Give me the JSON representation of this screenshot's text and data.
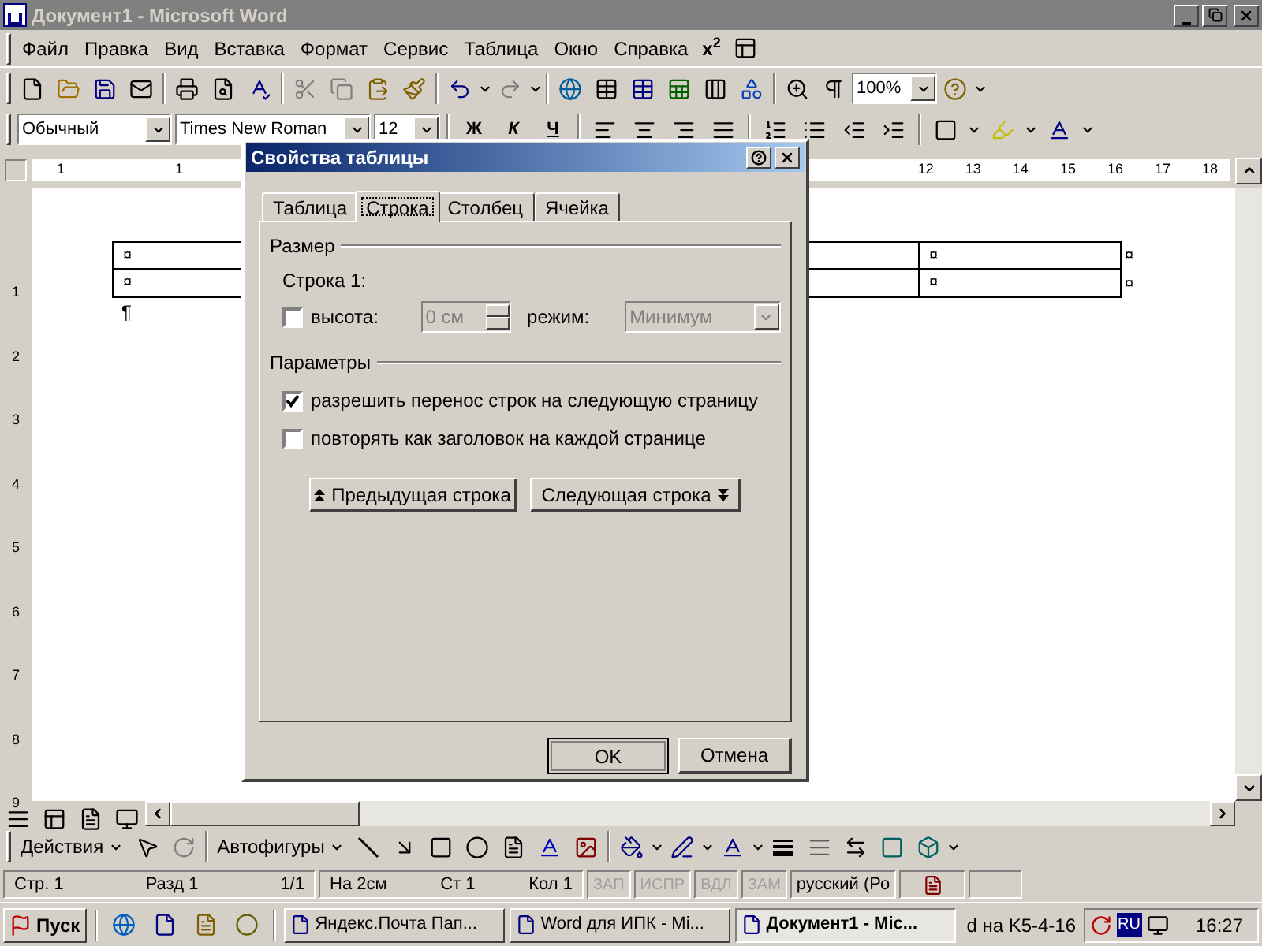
{
  "window": {
    "title": "Документ1 - Microsoft Word"
  },
  "menu": [
    "Файл",
    "Правка",
    "Вид",
    "Вставка",
    "Формат",
    "Сервис",
    "Таблица",
    "Окно",
    "Справка"
  ],
  "superscript_button": "x$^{2}$",
  "standard_toolbar": {
    "zoom": "100%"
  },
  "formatting_toolbar": {
    "style": "Обычный",
    "font": "Times New Roman",
    "size": "12",
    "bold": "Ж",
    "italic": "К",
    "underline": "Ч"
  },
  "ruler": {
    "left_numbers": [
      "1",
      "1"
    ],
    "right_numbers": [
      "12",
      "13",
      "14",
      "15",
      "16",
      "17",
      "18"
    ]
  },
  "vertical_ruler": [
    "1",
    "2",
    "3",
    "4",
    "5",
    "6",
    "7",
    "8",
    "9"
  ],
  "document": {
    "table": {
      "rows": [
        {
          "first": "¤",
          "last": "¤",
          "end": "¤"
        },
        {
          "first": "¤",
          "last": "¤",
          "end": "¤"
        }
      ]
    },
    "paragraph_mark": "¶"
  },
  "dialog": {
    "title": "Свойства таблицы",
    "tabs": [
      {
        "label": "Таблица",
        "selected": false
      },
      {
        "label": "Строка",
        "selected": true
      },
      {
        "label": "Столбец",
        "selected": false
      },
      {
        "label": "Ячейка",
        "selected": false
      }
    ],
    "size_group": "Размер",
    "row_label": "Строка 1:",
    "height": {
      "label": "высота:",
      "checked": false,
      "value": "0 см",
      "disabled": true
    },
    "mode": {
      "label": "режим:",
      "value": "Минимум",
      "disabled": true
    },
    "options_group": "Параметры",
    "options": [
      {
        "label": "разрешить перенос строк на следующую страницу",
        "checked": true
      },
      {
        "label": "повторять как заголовок на каждой странице",
        "checked": false
      }
    ],
    "prev_button": "Предыдущая строка",
    "next_button": "Следующая строка",
    "ok": "OK",
    "cancel": "Отмена"
  },
  "drawing_toolbar": {
    "actions": "Действия",
    "autoshapes": "Автофигуры"
  },
  "status_bar": {
    "fields": [
      "Стр. 1",
      "Разд 1",
      "1/1",
      "На 2см",
      "Ст 1",
      "Кол 1"
    ],
    "modes": [
      {
        "label": "ЗАП",
        "disabled": true
      },
      {
        "label": "ИСПР",
        "disabled": true
      },
      {
        "label": "ВДЛ",
        "disabled": true
      },
      {
        "label": "ЗАМ",
        "disabled": true
      }
    ],
    "language": "русский (Ро"
  },
  "taskbar": {
    "start": "Пуск",
    "tasks": [
      {
        "label": "Яндекс.Почта Пап...",
        "selected": false
      },
      {
        "label": "Word для  ИПК - Mi...",
        "selected": false
      },
      {
        "label": "Документ1 - Mic...",
        "selected": true
      }
    ],
    "tray_text": "d на K5-4-16",
    "lang": "RU",
    "clock": "16:27"
  }
}
